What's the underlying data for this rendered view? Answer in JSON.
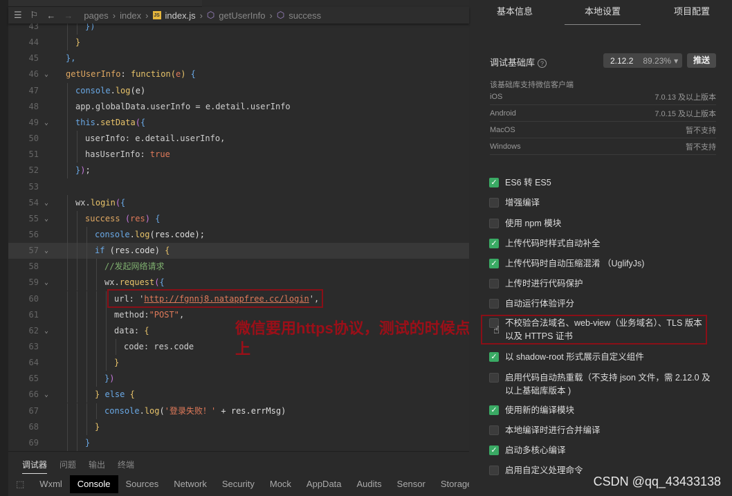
{
  "breadcrumb": {
    "items": [
      "pages",
      "index",
      "index.js",
      "getUserInfo",
      "success"
    ],
    "file_tab": "index.js"
  },
  "code": [
    {
      "n": 43,
      "i": 4,
      "t": [
        [
          "bl",
          "})"
        ]
      ]
    },
    {
      "n": 44,
      "i": 2,
      "t": [
        [
          "b",
          "}"
        ]
      ]
    },
    {
      "n": 45,
      "i": 0,
      "t": [
        [
          "bl",
          "},"
        ]
      ]
    },
    {
      "n": 46,
      "i": 0,
      "fold": true,
      "t": [
        [
          "p",
          "getUserInfo"
        ],
        [
          "o",
          ": "
        ],
        [
          "f",
          "function"
        ],
        [
          "b",
          "("
        ],
        [
          "s",
          "e"
        ],
        [
          "b",
          ")"
        ],
        [
          "o",
          " "
        ],
        [
          "bl",
          "{"
        ]
      ]
    },
    {
      "n": 47,
      "i": 2,
      "t": [
        [
          "k",
          "console"
        ],
        [
          "o",
          "."
        ],
        [
          "f",
          "log"
        ],
        [
          "o",
          "(e)"
        ]
      ]
    },
    {
      "n": 48,
      "i": 2,
      "t": [
        [
          "v",
          "app.globalData.userInfo = e.detail.userInfo"
        ]
      ]
    },
    {
      "n": 49,
      "i": 2,
      "fold": true,
      "t": [
        [
          "k",
          "this"
        ],
        [
          "o",
          "."
        ],
        [
          "f",
          "setData"
        ],
        [
          "m",
          "("
        ],
        [
          "bl",
          "{"
        ]
      ]
    },
    {
      "n": 50,
      "i": 4,
      "t": [
        [
          "v",
          "userInfo: e.detail.userInfo,"
        ]
      ]
    },
    {
      "n": 51,
      "i": 4,
      "t": [
        [
          "v",
          "hasUserInfo: "
        ],
        [
          "s",
          "true"
        ]
      ]
    },
    {
      "n": 52,
      "i": 2,
      "t": [
        [
          "bl",
          "}"
        ],
        [
          "m",
          ")"
        ],
        [
          "o",
          ";"
        ]
      ]
    },
    {
      "n": 53,
      "i": 0,
      "t": []
    },
    {
      "n": 54,
      "i": 2,
      "fold": true,
      "t": [
        [
          "v",
          "wx."
        ],
        [
          "f",
          "login"
        ],
        [
          "m",
          "("
        ],
        [
          "bl",
          "{"
        ]
      ]
    },
    {
      "n": 55,
      "i": 4,
      "fold": true,
      "t": [
        [
          "p",
          "success"
        ],
        [
          "o",
          " "
        ],
        [
          "m",
          "("
        ],
        [
          "s",
          "res"
        ],
        [
          "m",
          ")"
        ],
        [
          "o",
          " "
        ],
        [
          "bl",
          "{"
        ]
      ]
    },
    {
      "n": 56,
      "i": 6,
      "t": [
        [
          "k",
          "console"
        ],
        [
          "o",
          "."
        ],
        [
          "f",
          "log"
        ],
        [
          "o",
          "(res.code);"
        ]
      ]
    },
    {
      "n": 57,
      "i": 6,
      "fold": true,
      "hl": true,
      "t": [
        [
          "k",
          "if"
        ],
        [
          "o",
          " (res.code) "
        ],
        [
          "b",
          "{"
        ]
      ]
    },
    {
      "n": 58,
      "i": 8,
      "t": [
        [
          "c",
          "//发起网络请求"
        ]
      ]
    },
    {
      "n": 59,
      "i": 8,
      "fold": true,
      "t": [
        [
          "v",
          "wx."
        ],
        [
          "f",
          "request"
        ],
        [
          "m",
          "("
        ],
        [
          "bl",
          "{"
        ]
      ]
    },
    {
      "n": 60,
      "i": 10,
      "t": [
        [
          "v",
          "url: '"
        ],
        [
          "u",
          "http://fgnnj8.natappfree.cc/login"
        ],
        [
          "v",
          "',"
        ]
      ]
    },
    {
      "n": 61,
      "i": 10,
      "t": [
        [
          "v",
          "method:"
        ],
        [
          "s",
          "\"POST\""
        ],
        [
          "v",
          ","
        ]
      ]
    },
    {
      "n": 62,
      "i": 10,
      "fold": true,
      "t": [
        [
          "v",
          "data: "
        ],
        [
          "b",
          "{"
        ]
      ]
    },
    {
      "n": 63,
      "i": 12,
      "t": [
        [
          "v",
          "code: res.code"
        ]
      ]
    },
    {
      "n": 64,
      "i": 10,
      "t": [
        [
          "b",
          "}"
        ]
      ]
    },
    {
      "n": 65,
      "i": 8,
      "t": [
        [
          "bl",
          "}"
        ],
        [
          "m",
          ")"
        ]
      ]
    },
    {
      "n": 66,
      "i": 6,
      "fold": true,
      "t": [
        [
          "b",
          "}"
        ],
        [
          "o",
          " "
        ],
        [
          "k",
          "else"
        ],
        [
          "o",
          " "
        ],
        [
          "b",
          "{"
        ]
      ]
    },
    {
      "n": 67,
      "i": 8,
      "t": [
        [
          "k",
          "console"
        ],
        [
          "o",
          "."
        ],
        [
          "f",
          "log"
        ],
        [
          "o",
          "("
        ],
        [
          "s",
          "'登录失败！'"
        ],
        [
          "o",
          " + res.errMsg)"
        ]
      ]
    },
    {
      "n": 68,
      "i": 6,
      "t": [
        [
          "b",
          "}"
        ]
      ]
    },
    {
      "n": 69,
      "i": 4,
      "t": [
        [
          "bl",
          "}"
        ]
      ]
    }
  ],
  "annotation": "微信要用https协议，测试的时候点上",
  "bottom": {
    "tabs": [
      "调试器",
      "问题",
      "输出",
      "终端"
    ],
    "devtools": [
      "Wxml",
      "Console",
      "Sources",
      "Network",
      "Security",
      "Mock",
      "AppData",
      "Audits",
      "Sensor",
      "Storage"
    ],
    "active_devtool": "Console"
  },
  "panel": {
    "tabs": [
      "基本信息",
      "本地设置",
      "项目配置"
    ],
    "active_tab": "本地设置",
    "lib_label": "调试基础库",
    "lib_version": "2.12.2",
    "lib_share": "89.23%",
    "push": "推送",
    "support_label": "该基础库支持微信客户端",
    "platforms": [
      [
        "iOS",
        "7.0.13 及以上版本"
      ],
      [
        "Android",
        "7.0.15 及以上版本"
      ],
      [
        "MacOS",
        "暂不支持"
      ],
      [
        "Windows",
        "暂不支持"
      ]
    ],
    "options": [
      {
        "label": "ES6 转 ES5",
        "checked": true
      },
      {
        "label": "增强编译",
        "checked": false
      },
      {
        "label": "使用 npm 模块",
        "checked": false
      },
      {
        "label": "上传代码时样式自动补全",
        "checked": true
      },
      {
        "label": "上传代码时自动压缩混淆 （UglifyJs)",
        "checked": true
      },
      {
        "label": "上传时进行代码保护",
        "checked": false
      },
      {
        "label": "自动运行体验评分",
        "checked": false
      },
      {
        "label": "不校验合法域名、web-view（业务域名）、TLS 版本以及 HTTPS 证书",
        "checked": false
      },
      {
        "label": "以 shadow-root 形式展示自定义组件",
        "checked": true
      },
      {
        "label": "启用代码自动热重载（不支持 json 文件，需 2.12.0 及以上基础库版本 )",
        "checked": false
      },
      {
        "label": "使用新的编译模块",
        "checked": true
      },
      {
        "label": "本地编译时进行合并编译",
        "checked": false
      },
      {
        "label": "启动多核心编译",
        "checked": true
      },
      {
        "label": "启用自定义处理命令",
        "checked": false
      }
    ]
  },
  "watermark": "CSDN @qq_43433138",
  "colors": {
    "highlight_box": "#8a0f17",
    "checkbox_on": "#3aaa64"
  }
}
